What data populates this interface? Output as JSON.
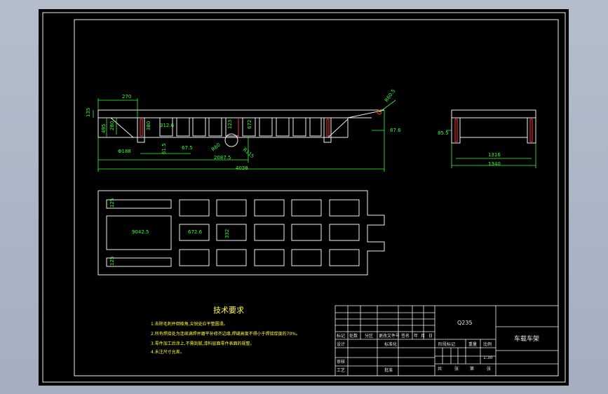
{
  "side_view": {
    "dims": {
      "d270": "270",
      "d135": "135",
      "d280": "280",
      "d495": "495",
      "d380": "380",
      "d312": "312.6",
      "d123": "123",
      "d672": "672",
      "r960": "R60.5",
      "d876": "87.6",
      "d675": "67.5",
      "d61": "61.5",
      "r60": "R60",
      "r115": "R115",
      "d2087": "2087.5",
      "d4038": "4038",
      "d0188": "Φ188"
    }
  },
  "end_view": {
    "dims": {
      "d85": "85.5",
      "d1316": "1316",
      "d1340": "1340"
    }
  },
  "plan_view": {
    "dims": {
      "d125a": "125",
      "d9042": "9042.5",
      "d672": "672.6",
      "d332": "332",
      "d125b": "125"
    }
  },
  "tech": {
    "title": "技术要求",
    "items": [
      "1.去除毛刺并倒棱角,尖锐处应平整圆滑。",
      "2.所有焊接处为连续满焊并磨平补修齐边缘,焊缝高度不得小于焊接厚度的70%。",
      "3.零件加工后涂上,不需刮腻,漆料层面零件表面的规整。",
      "4.未注尺寸允差。"
    ]
  },
  "title_block": {
    "material": "Q235",
    "part_name": "车载车架",
    "scale": "1:30",
    "col_labels": [
      "标记",
      "处数",
      "分区",
      "更改文件号",
      "签名",
      "年",
      "月",
      "日"
    ],
    "design": "设计",
    "standard": "标准化",
    "stage": "阶段标记",
    "weight": "重量",
    "scale_label": "比例",
    "review": "审核",
    "process": "工艺",
    "approve": "批准",
    "sheets": [
      "共",
      "张",
      "第",
      "张"
    ]
  }
}
